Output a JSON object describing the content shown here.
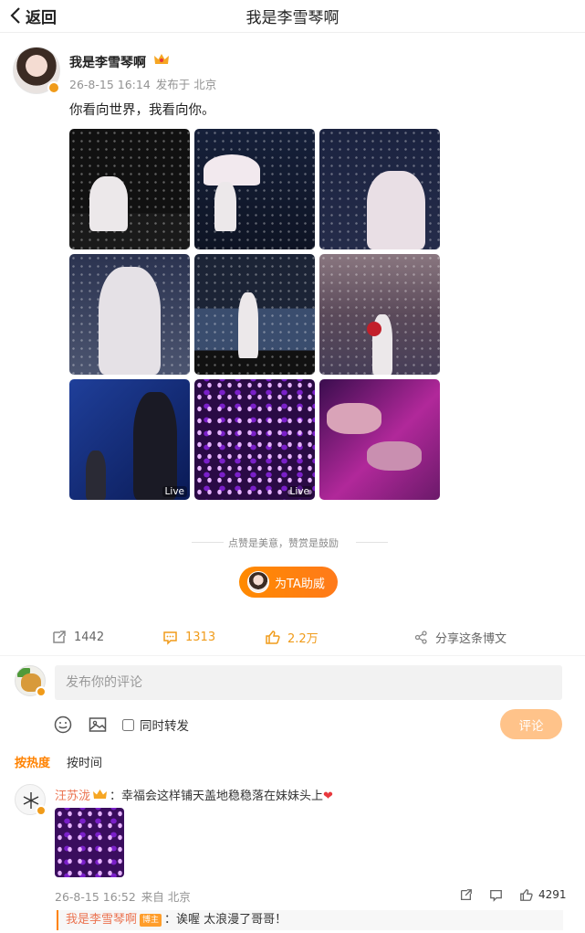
{
  "header": {
    "back_label": "返回",
    "title": "我是李雪琴啊"
  },
  "post": {
    "author": "我是李雪琴啊",
    "time": "26-8-15 16:14",
    "location": "发布于 北京",
    "text": "你看向世界，我看向你。",
    "photos": [
      {
        "live": ""
      },
      {
        "live": ""
      },
      {
        "live": ""
      },
      {
        "live": ""
      },
      {
        "live": ""
      },
      {
        "live": ""
      },
      {
        "live": "Live"
      },
      {
        "live": "Live"
      },
      {
        "live": ""
      }
    ],
    "divider_text": "点赞是美意，赞赏是鼓励",
    "cheer_label": "为TA助威"
  },
  "actions": {
    "repost_count": "1442",
    "comment_count": "1313",
    "like_count": "2.2万",
    "share_label": "分享这条博文",
    "like_color": "#f09b1a"
  },
  "composer": {
    "placeholder": "发布你的评论",
    "repost_label": "同时转发",
    "submit_label": "评论"
  },
  "sort": {
    "hot": "按热度",
    "time": "按时间"
  },
  "comments": [
    {
      "user": "汪苏泷",
      "text": "：幸福会这样铺天盖地稳稳落在妹妹头上",
      "time": "26-8-15 16:52",
      "location": "来自 北京",
      "likes": "4291",
      "reply": {
        "user": "我是李雪琴啊",
        "tag": "博主",
        "text": "：诶喔 太浪漫了哥哥！"
      }
    }
  ],
  "colors": {
    "accent": "#ff8200",
    "username": "#eb7350",
    "submit_disabled": "#ffc38a"
  }
}
